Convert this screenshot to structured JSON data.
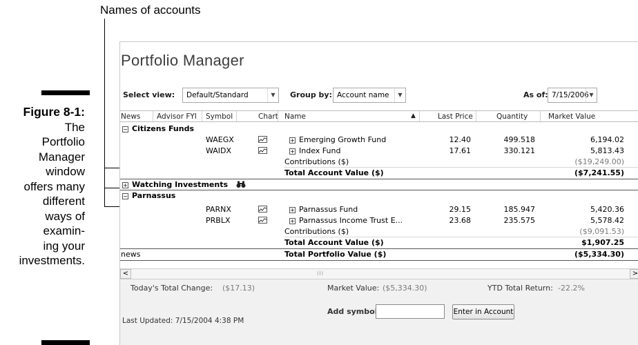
{
  "callout": {
    "text": "Names of accounts"
  },
  "figure": {
    "label": "Figure 8-1:",
    "lines": [
      "The",
      "Portfolio",
      "Manager",
      "window",
      "offers many",
      "different",
      "ways of",
      "examin-",
      "ing your",
      "investments."
    ]
  },
  "window": {
    "title": "Portfolio Manager",
    "toolbar": {
      "select_view_label": "Select view:",
      "select_view_value": "Default/Standard",
      "group_by_label": "Group by:",
      "group_by_value": "Account name",
      "as_of_label": "As of:",
      "as_of_value": "7/15/2006"
    },
    "columns": {
      "news": "News",
      "advisor": "Advisor FYI",
      "symbol": "Symbol",
      "chart": "Chart",
      "name": "Name",
      "sort_indicator": "▲",
      "last_price": "Last Price",
      "quantity": "Quantity",
      "market_value": "Market Value"
    },
    "groups": {
      "citizens": {
        "toggle": "−",
        "title": "Citizens Funds",
        "rows": [
          {
            "symbol": "WAEGX",
            "toggle": "+",
            "name": "Emerging Growth Fund",
            "last_price": "12.40",
            "quantity": "499.518",
            "market_value": "6,194.02"
          },
          {
            "symbol": "WAIDX",
            "toggle": "+",
            "name": "Index Fund",
            "last_price": "17.61",
            "quantity": "330.121",
            "market_value": "5,813.43"
          }
        ],
        "contributions_label": "Contributions ($)",
        "contributions_value": "($19,249.00)",
        "total_label": "Total Account Value ($)",
        "total_value": "($7,241.55)"
      },
      "watching": {
        "toggle": "+",
        "title": "Watching Investments",
        "icon": "binoculars-icon"
      },
      "parnassus": {
        "toggle": "−",
        "title": "Parnassus",
        "rows": [
          {
            "symbol": "PARNX",
            "toggle": "+",
            "name": "Parnassus Fund",
            "last_price": "29.15",
            "quantity": "185.947",
            "market_value": "5,420.36"
          },
          {
            "symbol": "PRBLX",
            "toggle": "+",
            "name": "Parnassus Income Trust E...",
            "last_price": "23.68",
            "quantity": "235.575",
            "market_value": "5,578.42"
          }
        ],
        "contributions_label": "Contributions ($)",
        "contributions_value": "($9,091.53)",
        "total_label": "Total Account Value ($)",
        "total_value": "$1,907.25"
      }
    },
    "portfolio_total": {
      "news": "news",
      "label": "Total Portfolio Value ($)",
      "value": "($5,334.30)"
    },
    "scrollbar": {
      "left": "<",
      "grip": "III",
      "right": ">"
    },
    "status": {
      "todays_change_label": "Today's Total Change:",
      "todays_change_value": "($17.13)",
      "market_value_label": "Market Value:",
      "market_value_value": "($5,334.30)",
      "ytd_label": "YTD Total Return:",
      "ytd_value": "-22.2%"
    },
    "footer": {
      "last_updated": "Last Updated: 7/15/2004 4:38 PM",
      "add_symbols_label": "Add symbols:",
      "add_symbols_value": "",
      "enter_button": "Enter in Account"
    }
  }
}
